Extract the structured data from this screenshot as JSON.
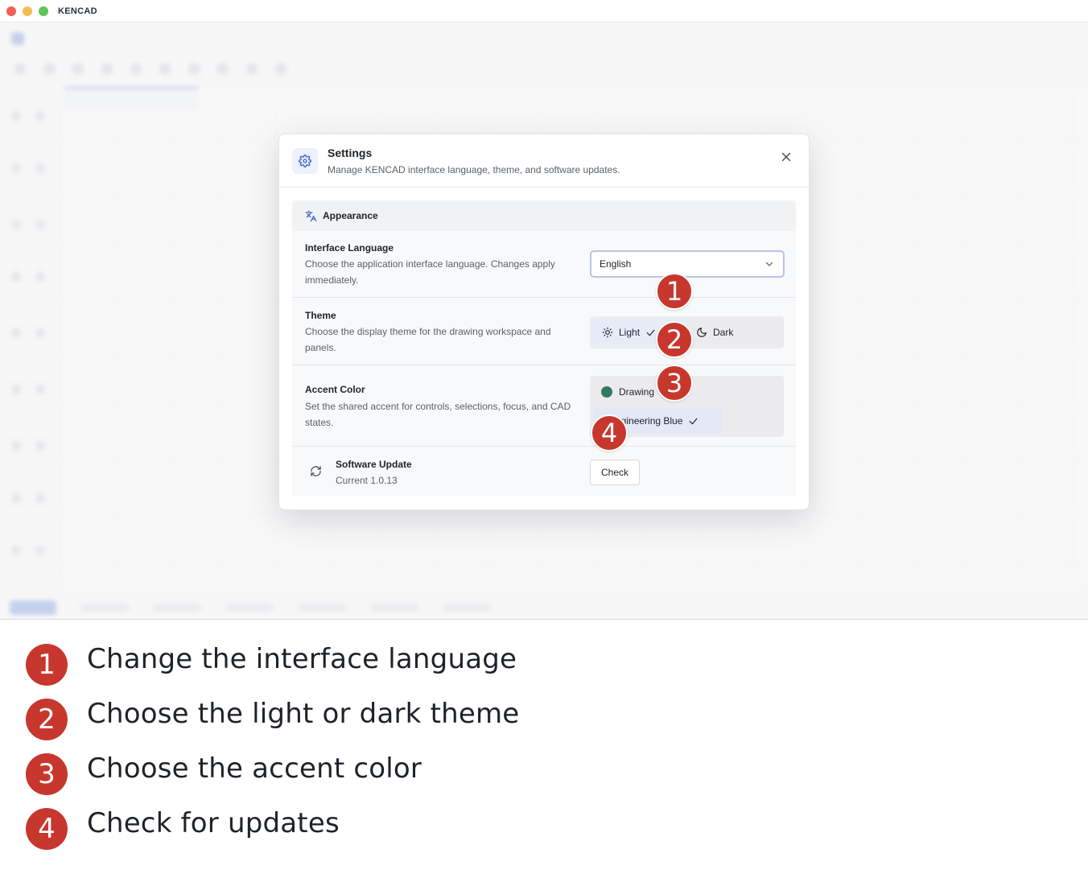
{
  "window": {
    "title": "KENCAD"
  },
  "dialog": {
    "title": "Settings",
    "subtitle": "Manage KENCAD interface language, theme, and software updates.",
    "icon": "gear-icon",
    "close_icon": "close-icon"
  },
  "appearance": {
    "header": "Appearance",
    "icon": "translate-icon",
    "language": {
      "title": "Interface Language",
      "desc": "Choose the application interface language. Changes apply immediately.",
      "value": "English"
    },
    "theme": {
      "title": "Theme",
      "desc": "Choose the display theme for the drawing workspace and panels.",
      "options": [
        "Light",
        "Dark"
      ],
      "selected": "Light"
    },
    "accent": {
      "title": "Accent Color",
      "desc": "Set the shared accent for controls, selections, focus, and CAD states.",
      "options": [
        {
          "label": "Drawing",
          "color": "#2f7a60"
        },
        {
          "label": "Engineering Blue",
          "color": "#3b64c8"
        }
      ],
      "selected": "Engineering Blue"
    },
    "update": {
      "title": "Software Update",
      "current": "Current 1.0.13",
      "button": "Check"
    }
  },
  "callouts": [
    "1",
    "2",
    "3",
    "4"
  ],
  "legend": [
    {
      "num": "1",
      "text": "Change the interface language"
    },
    {
      "num": "2",
      "text": "Choose the light or dark theme"
    },
    {
      "num": "3",
      "text": "Choose the accent color"
    },
    {
      "num": "4",
      "text": "Check for updates"
    }
  ],
  "colors": {
    "badge": "#c8372d",
    "accent_blue": "#3b64c8",
    "accent_green": "#2f7a60"
  }
}
